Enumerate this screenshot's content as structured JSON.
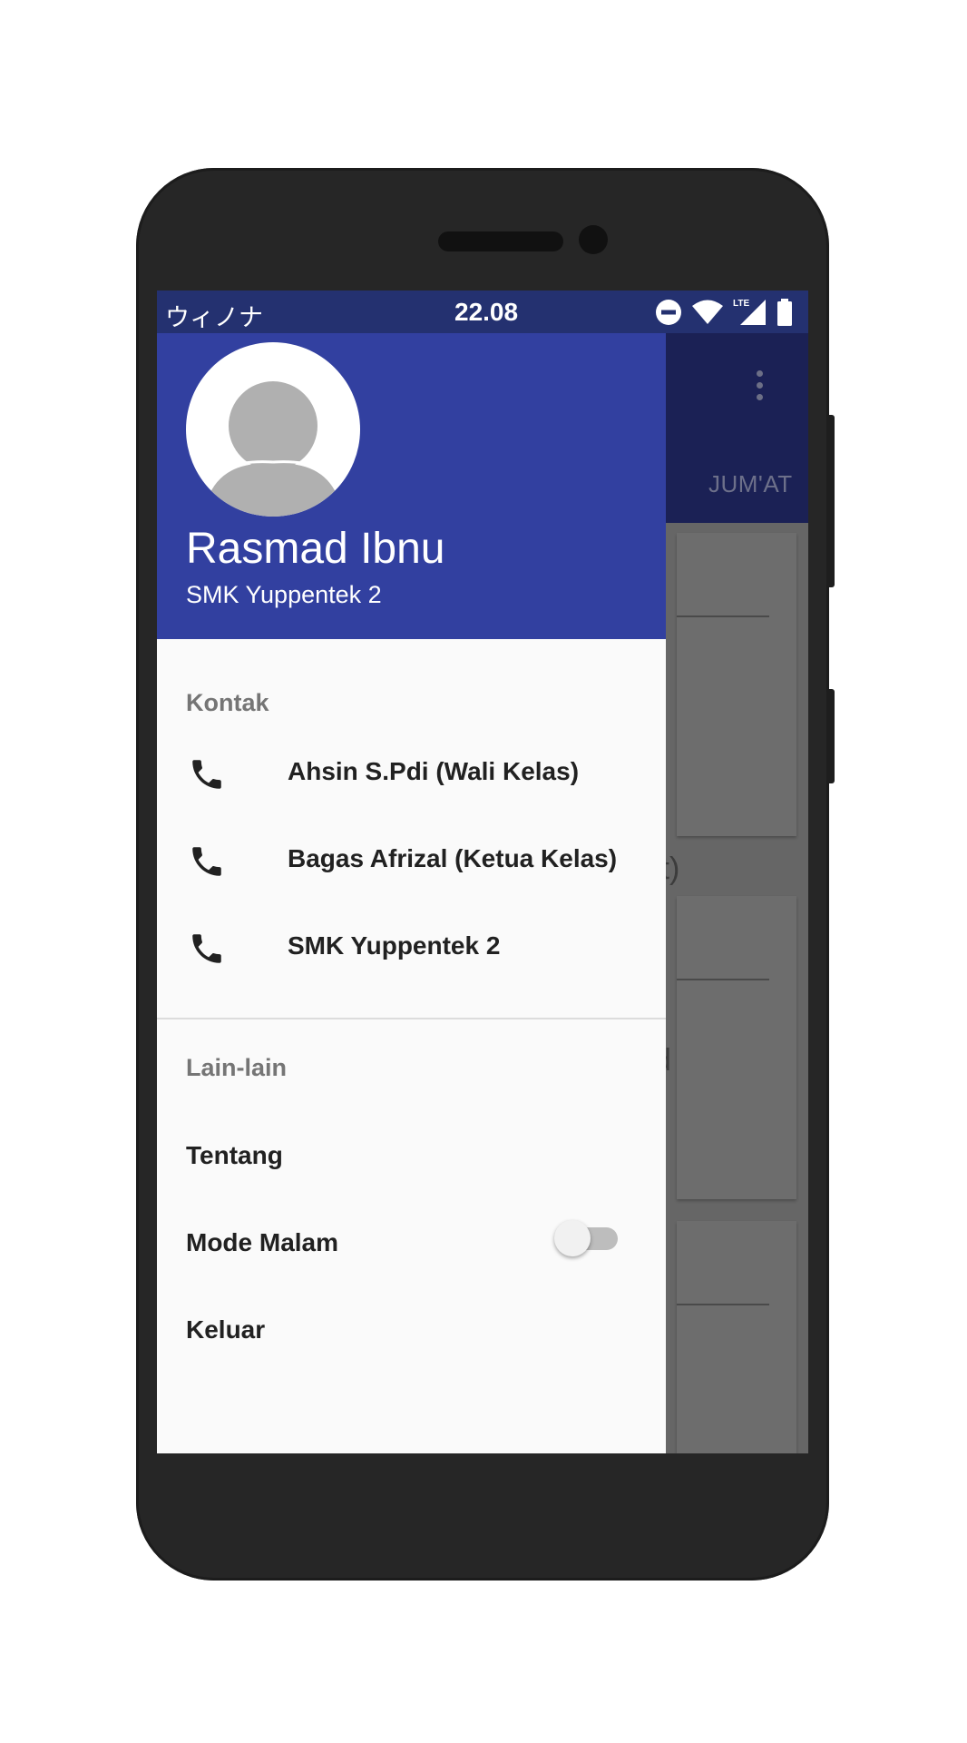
{
  "status_bar": {
    "carrier": "ウィノナ",
    "time": "22.08",
    "network": "LTE"
  },
  "background_app": {
    "tab_label": "JUM'AT",
    "fragment_1": "it)",
    "fragment_2": "d"
  },
  "drawer": {
    "header": {
      "name": "Rasmad Ibnu",
      "subtitle": "SMK Yuppentek 2"
    },
    "contacts": {
      "title": "Kontak",
      "items": [
        {
          "label": "Ahsin S.Pdi (Wali Kelas)",
          "icon": "phone-icon"
        },
        {
          "label": "Bagas Afrizal (Ketua Kelas)",
          "icon": "phone-icon"
        },
        {
          "label": "SMK Yuppentek 2",
          "icon": "phone-icon"
        }
      ]
    },
    "others": {
      "title": "Lain-lain",
      "about": "Tentang",
      "night_mode": "Mode Malam",
      "night_mode_on": false,
      "logout": "Keluar"
    }
  },
  "colors": {
    "header": "#3240a0",
    "status_bar": "#243170",
    "drawer_bg": "#fafafa"
  }
}
